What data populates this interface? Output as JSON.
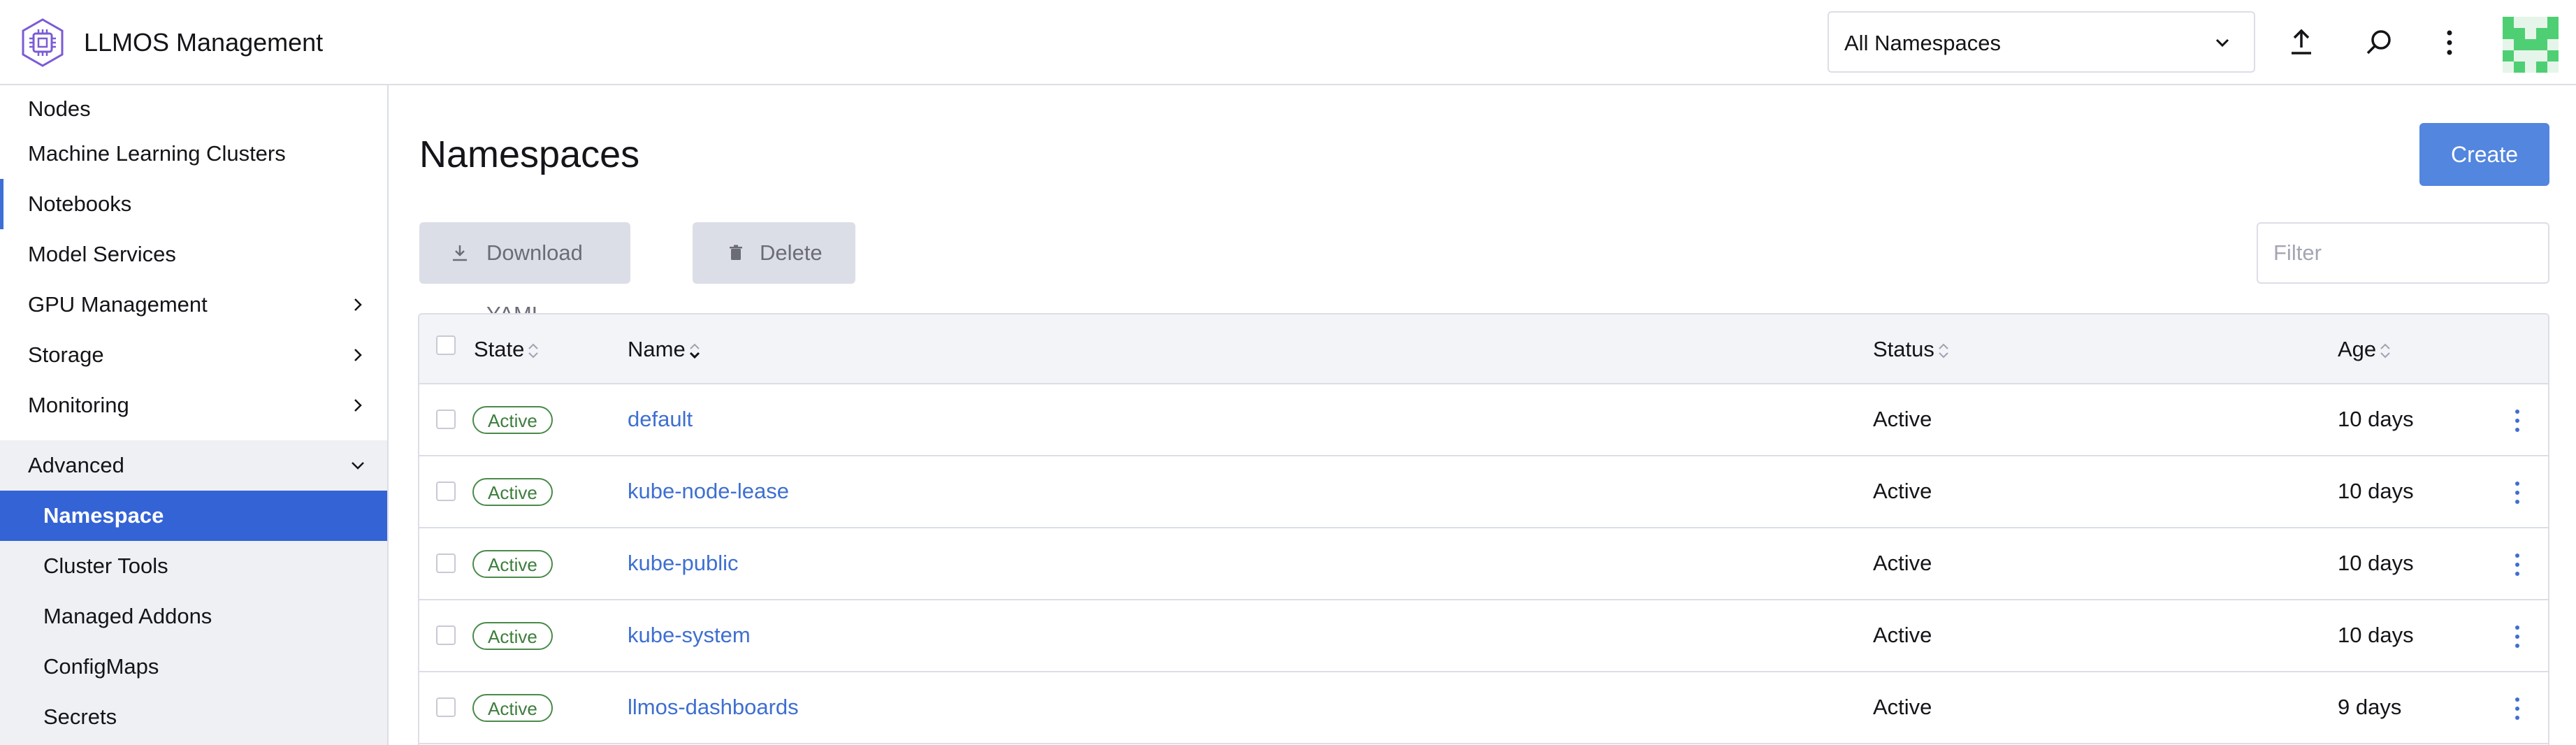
{
  "app": {
    "title": "LLMOS Management"
  },
  "header": {
    "namespace_select": {
      "value": "All Namespaces"
    }
  },
  "sidebar": {
    "items": [
      {
        "label": "Nodes"
      },
      {
        "label": "Machine Learning Clusters"
      },
      {
        "label": "Notebooks"
      },
      {
        "label": "Model Services"
      },
      {
        "label": "GPU Management"
      },
      {
        "label": "Storage"
      },
      {
        "label": "Monitoring"
      },
      {
        "label": "Advanced"
      }
    ],
    "advanced_items": [
      {
        "label": "Namespace"
      },
      {
        "label": "Cluster Tools"
      },
      {
        "label": "Managed Addons"
      },
      {
        "label": "ConfigMaps"
      },
      {
        "label": "Secrets"
      }
    ]
  },
  "main": {
    "title": "Namespaces",
    "create_label": "Create",
    "download_label": "Download YAML",
    "delete_label": "Delete",
    "filter_placeholder": "Filter",
    "columns": {
      "state": "State",
      "name": "Name",
      "status": "Status",
      "age": "Age"
    },
    "rows": [
      {
        "state": "Active",
        "name": "default",
        "status": "Active",
        "age": "10 days"
      },
      {
        "state": "Active",
        "name": "kube-node-lease",
        "status": "Active",
        "age": "10 days"
      },
      {
        "state": "Active",
        "name": "kube-public",
        "status": "Active",
        "age": "10 days"
      },
      {
        "state": "Active",
        "name": "kube-system",
        "status": "Active",
        "age": "10 days"
      },
      {
        "state": "Active",
        "name": "llmos-dashboards",
        "status": "Active",
        "age": "9 days"
      }
    ]
  },
  "colors": {
    "accent": "#3463d5",
    "primary_button": "#5286df",
    "link": "#3e6fd1",
    "active_badge": "#3d7d3d"
  },
  "icons": {
    "logo": "chip-hexagon-icon",
    "upload": "upload-icon",
    "search": "search-icon",
    "menu": "more-vertical-icon",
    "download": "download-icon",
    "delete": "trash-icon"
  }
}
